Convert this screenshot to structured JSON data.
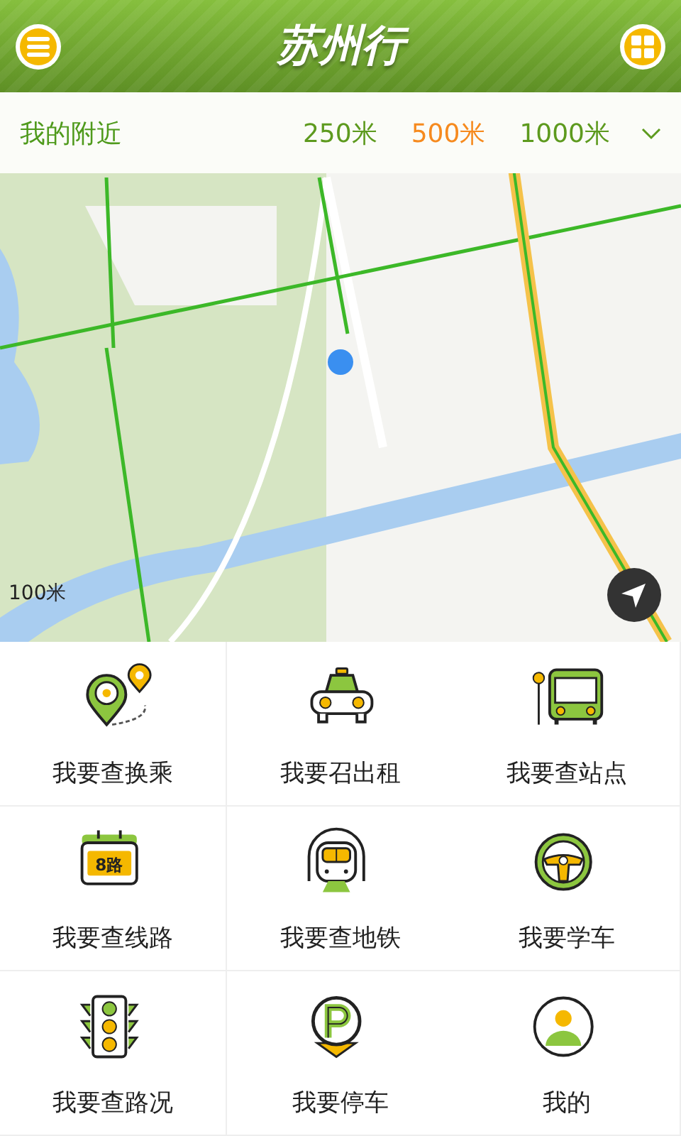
{
  "header": {
    "title": "苏州行"
  },
  "nearby": {
    "label": "我的附近",
    "options": [
      {
        "label": "250米",
        "selected": false
      },
      {
        "label": "500米",
        "selected": true
      },
      {
        "label": "1000米",
        "selected": false
      }
    ]
  },
  "map": {
    "scale": "100米"
  },
  "features": [
    {
      "kind": "transfer",
      "label": "我要查换乘"
    },
    {
      "kind": "taxi",
      "label": "我要召出租"
    },
    {
      "kind": "station",
      "label": "我要查站点"
    },
    {
      "kind": "line",
      "label": "我要查线路",
      "icon_text": "8路"
    },
    {
      "kind": "subway",
      "label": "我要查地铁"
    },
    {
      "kind": "driving",
      "label": "我要学车"
    },
    {
      "kind": "traffic",
      "label": "我要查路况"
    },
    {
      "kind": "parking",
      "label": "我要停车"
    },
    {
      "kind": "profile",
      "label": "我的"
    }
  ]
}
